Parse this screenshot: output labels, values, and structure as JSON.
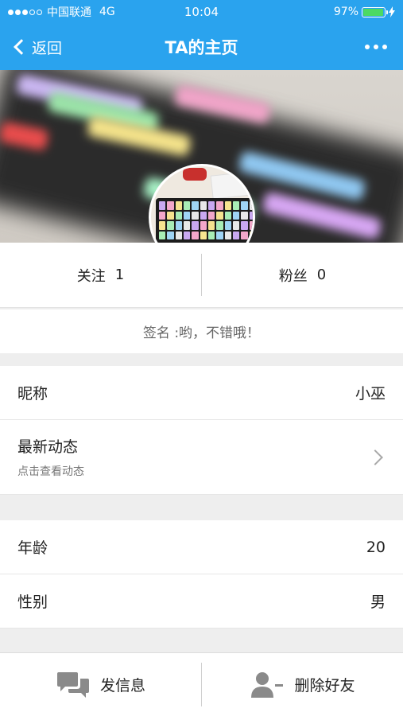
{
  "status_bar": {
    "carrier": "中国联通",
    "network": "4G",
    "time": "10:04",
    "battery": "97%",
    "battery_level": 0.97
  },
  "nav": {
    "back_label": "返回",
    "title": "TA的主页",
    "more_icon": "more-dots-icon"
  },
  "stats": {
    "follow_label": "关注",
    "follow_count": "1",
    "fans_label": "粉丝",
    "fans_count": "0"
  },
  "signature": "签名 :哟，不错哦！",
  "info": {
    "nickname_label": "昵称",
    "nickname_value": "小巫",
    "moments_label": "最新动态",
    "moments_sub": "点击查看动态",
    "age_label": "年龄",
    "age_value": "20",
    "gender_label": "性别",
    "gender_value": "男"
  },
  "bottom_bar": {
    "message_label": "发信息",
    "message_icon": "chat-bubbles-icon",
    "delete_label": "删除好友",
    "delete_icon": "remove-user-icon"
  },
  "colors": {
    "accent": "#2aa3ee",
    "battery_fill": "#4cd964"
  }
}
